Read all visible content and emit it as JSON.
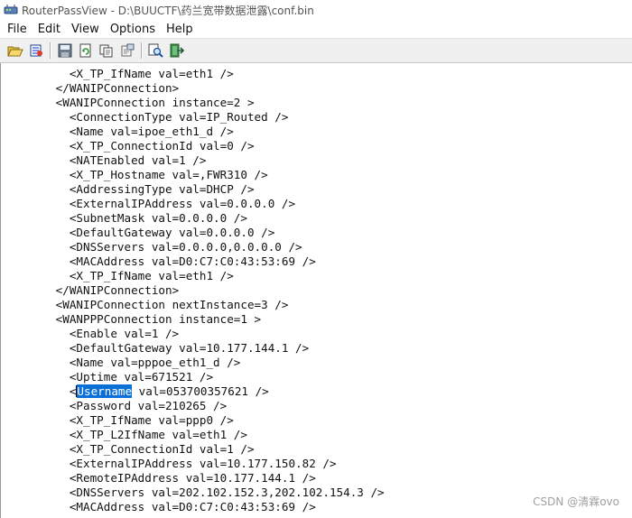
{
  "window": {
    "title": "RouterPassView  -  D:\\BUUCTF\\药兰宽带数据泄露\\conf.bin"
  },
  "menu": [
    "File",
    "Edit",
    "View",
    "Options",
    "Help"
  ],
  "toolbar": {
    "buttons": [
      {
        "name": "open-icon"
      },
      {
        "name": "open-file-icon"
      },
      {
        "name": "save-icon"
      },
      {
        "name": "refresh-icon"
      },
      {
        "name": "copy-icon"
      },
      {
        "name": "properties-icon"
      },
      {
        "name": "find-icon"
      },
      {
        "name": "exit-icon"
      }
    ]
  },
  "document": {
    "lines": [
      {
        "indent": 10,
        "text": "<X_TP_IfName val=eth1 />"
      },
      {
        "indent": 8,
        "text": "</WANIPConnection>"
      },
      {
        "indent": 8,
        "text": "<WANIPConnection instance=2 >"
      },
      {
        "indent": 10,
        "text": "<ConnectionType val=IP_Routed />"
      },
      {
        "indent": 10,
        "text": "<Name val=ipoe_eth1_d />"
      },
      {
        "indent": 10,
        "text": "<X_TP_ConnectionId val=0 />"
      },
      {
        "indent": 10,
        "text": "<NATEnabled val=1 />"
      },
      {
        "indent": 10,
        "text": "<X_TP_Hostname val=,FWR310 />"
      },
      {
        "indent": 10,
        "text": "<AddressingType val=DHCP />"
      },
      {
        "indent": 10,
        "text": "<ExternalIPAddress val=0.0.0.0 />"
      },
      {
        "indent": 10,
        "text": "<SubnetMask val=0.0.0.0 />"
      },
      {
        "indent": 10,
        "text": "<DefaultGateway val=0.0.0.0 />"
      },
      {
        "indent": 10,
        "text": "<DNSServers val=0.0.0.0,0.0.0.0 />"
      },
      {
        "indent": 10,
        "text": "<MACAddress val=D0:C7:C0:43:53:69 />"
      },
      {
        "indent": 10,
        "text": "<X_TP_IfName val=eth1 />"
      },
      {
        "indent": 8,
        "text": "</WANIPConnection>"
      },
      {
        "indent": 8,
        "text": "<WANIPConnection nextInstance=3 />"
      },
      {
        "indent": 8,
        "text": "<WANPPPConnection instance=1 >"
      },
      {
        "indent": 10,
        "text": "<Enable val=1 />"
      },
      {
        "indent": 10,
        "text": "<DefaultGateway val=10.177.144.1 />"
      },
      {
        "indent": 10,
        "text": "<Name val=pppoe_eth1_d />"
      },
      {
        "indent": 10,
        "text": "<Uptime val=671521 />"
      },
      {
        "indent": 10,
        "pre": "<",
        "highlight": "Username",
        "post": " val=053700357621 />"
      },
      {
        "indent": 10,
        "text": "<Password val=210265 />"
      },
      {
        "indent": 10,
        "text": "<X_TP_IfName val=ppp0 />"
      },
      {
        "indent": 10,
        "text": "<X_TP_L2IfName val=eth1 />"
      },
      {
        "indent": 10,
        "text": "<X_TP_ConnectionId val=1 />"
      },
      {
        "indent": 10,
        "text": "<ExternalIPAddress val=10.177.150.82 />"
      },
      {
        "indent": 10,
        "text": "<RemoteIPAddress val=10.177.144.1 />"
      },
      {
        "indent": 10,
        "text": "<DNSServers val=202.102.152.3,202.102.154.3 />"
      },
      {
        "indent": 10,
        "text": "<MACAddress val=D0:C7:C0:43:53:69 />"
      }
    ]
  },
  "watermark": "CSDN @清霖ovo"
}
